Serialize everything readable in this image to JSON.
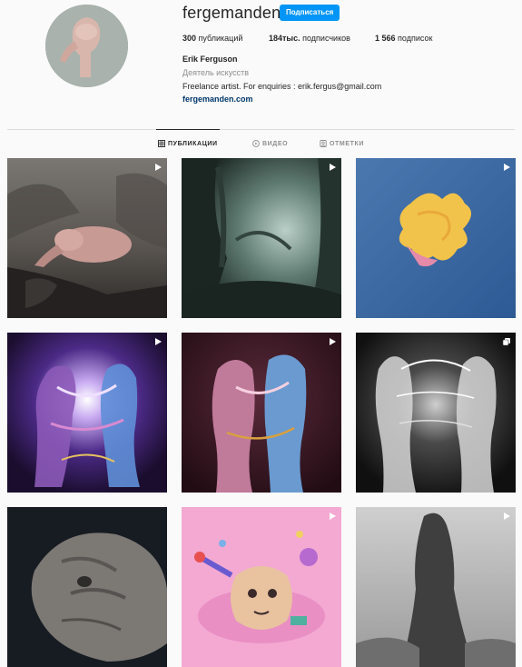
{
  "profile": {
    "username": "fergemanden",
    "follow_label": "Подписаться",
    "stats": {
      "posts_count": "300",
      "posts_label": " публикаций",
      "followers_count": "184тыс.",
      "followers_label": " подписчиков",
      "following_count": "1 566",
      "following_label": " подписок"
    },
    "full_name": "Erik Ferguson",
    "category": "Деятель искусств",
    "bio": "Freelance artist. For enquiries : erik.fergus@gmail.com",
    "link": "fergemanden.com"
  },
  "tabs": [
    {
      "label": "ПУБЛИКАЦИИ",
      "icon": "grid-icon",
      "active": true
    },
    {
      "label": "ВИДЕО",
      "icon": "video-icon",
      "active": false
    },
    {
      "label": "ОТМЕТКИ",
      "icon": "tag-icon",
      "active": false
    }
  ],
  "posts": [
    {
      "badge": "video-icon"
    },
    {
      "badge": "video-icon"
    },
    {
      "badge": "video-icon"
    },
    {
      "badge": "video-icon"
    },
    {
      "badge": "video-icon"
    },
    {
      "badge": "carousel-icon"
    },
    {
      "badge": "none"
    },
    {
      "badge": "video-icon"
    },
    {
      "badge": "video-icon"
    }
  ],
  "colors": {
    "accent": "#0095f6",
    "link": "#00376b",
    "muted": "#8e8e8e"
  }
}
